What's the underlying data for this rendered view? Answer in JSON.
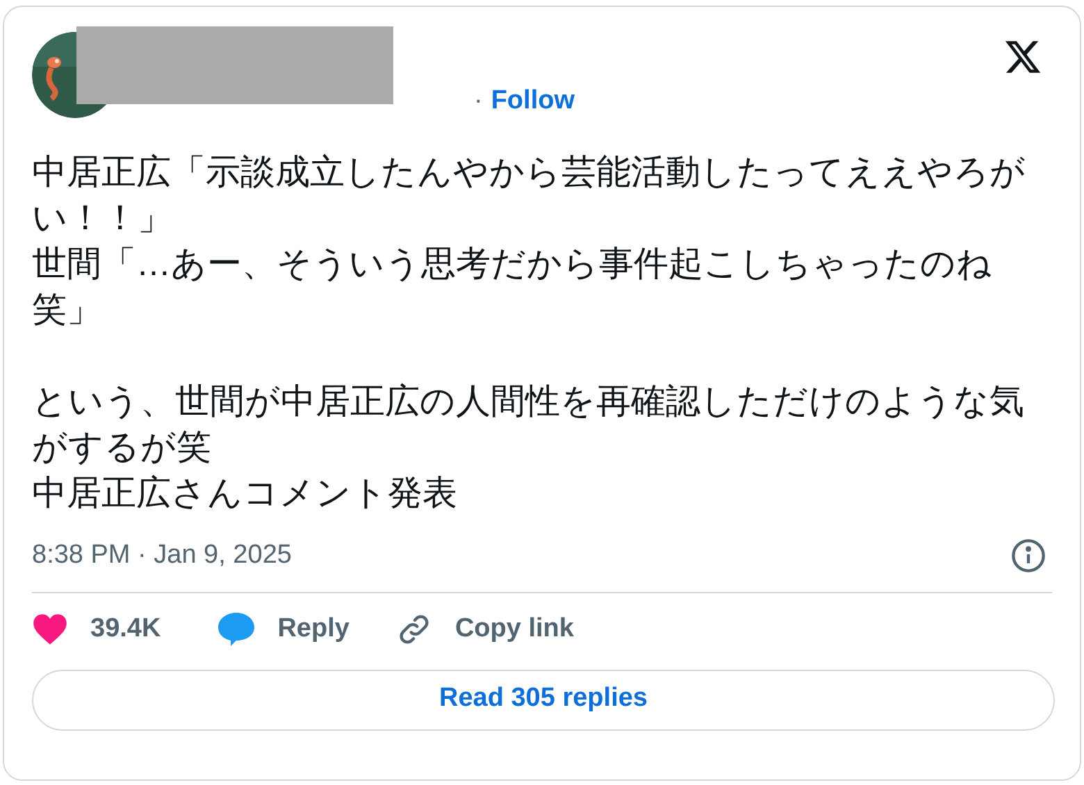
{
  "header": {
    "separator": "·",
    "follow": "Follow"
  },
  "body": {
    "paragraphs": [
      [
        "中居正広「示談成立したんやから芸能活動したってええやろがい！！」",
        "世間「…あー、そういう思考だから事件起こしちゃったのね笑」"
      ],
      [
        "という、世間が中居正広の人間性を再確認しただけのような気がするが笑",
        "中居正広さんコメント発表"
      ]
    ]
  },
  "timestamp": "8:38 PM · Jan 9, 2025",
  "actions": {
    "likes": "39.4K",
    "reply": "Reply",
    "copy_link": "Copy link"
  },
  "read_replies": "Read 305 replies"
}
